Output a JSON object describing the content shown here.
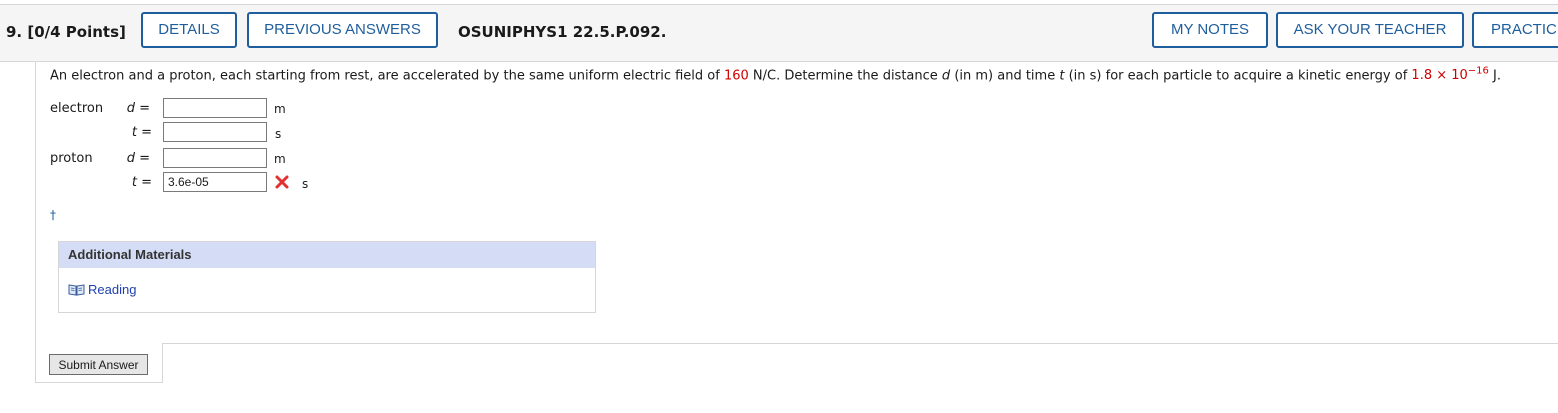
{
  "header": {
    "question_number": "9.",
    "points": "[0/4 Points]",
    "details_label": "DETAILS",
    "previous_answers_label": "PREVIOUS ANSWERS",
    "question_code": "OSUNIPHYS1 22.5.P.092.",
    "my_notes_label": "MY NOTES",
    "ask_teacher_label": "ASK YOUR TEACHER",
    "practice_label": "PRACTICE ANOTHER"
  },
  "prompt": {
    "part1": "An electron and a proton, each starting from rest, are accelerated by the same uniform electric field of ",
    "field_value": "160",
    "part2": " N/C. Determine the distance ",
    "var_d": "d",
    "part3": " (in m) and time ",
    "var_t": "t",
    "part4": " (in s) for each particle to acquire a kinetic energy of ",
    "energy_value": "1.8 × 10",
    "energy_exponent": "−16",
    "part5": " J."
  },
  "answers": {
    "electron_label": "electron",
    "proton_label": "proton",
    "d_eq": "d =",
    "t_eq": "t =",
    "unit_m": "m",
    "unit_s": "s",
    "electron_d": "",
    "electron_t": "",
    "proton_d": "",
    "proton_t": "3.6e-05",
    "proton_t_status": "incorrect"
  },
  "footnote_symbol": "†",
  "additional_materials": {
    "title": "Additional Materials",
    "reading_label": "Reading"
  },
  "submit_label": "Submit Answer",
  "colors": {
    "accent": "#1f5e9c",
    "given_value": "#d00000",
    "incorrect": "#e03030",
    "materials_header": "#d4ddf5"
  }
}
